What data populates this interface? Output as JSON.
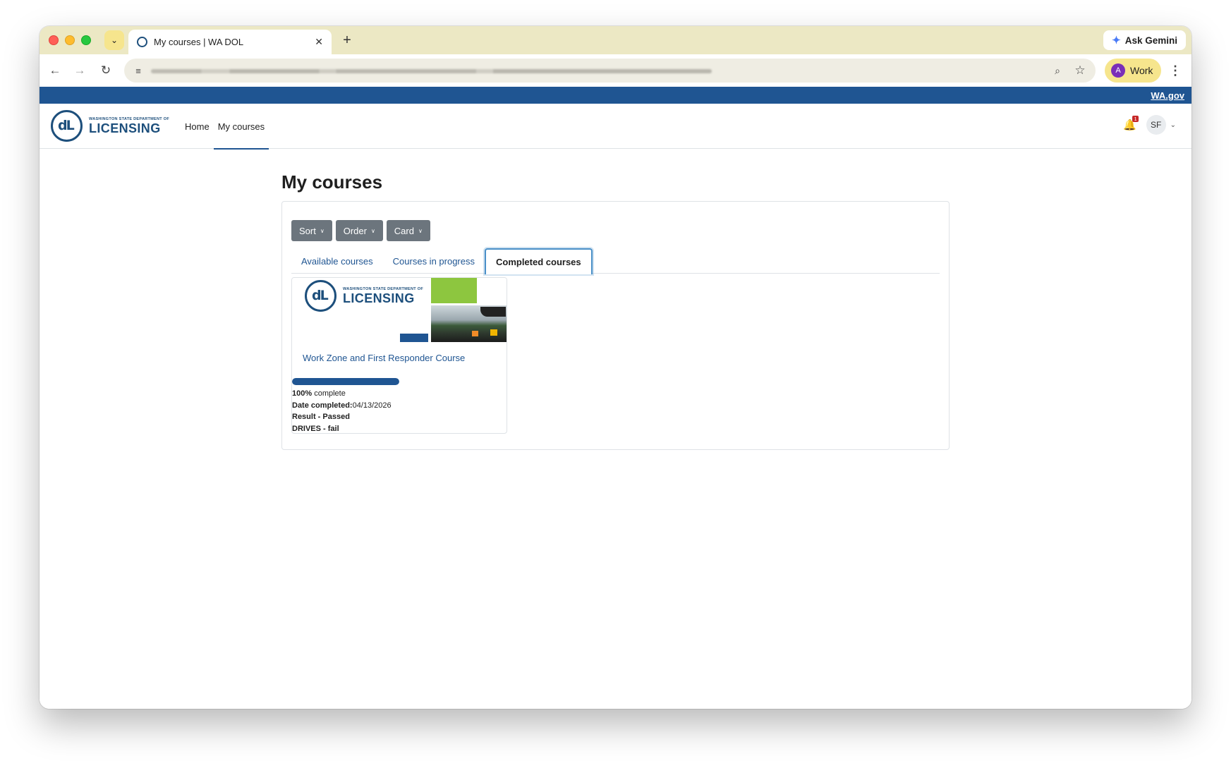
{
  "browser": {
    "tab_title": "My courses | WA DOL",
    "new_tab_label": "+",
    "ask_gemini_label": "Ask Gemini",
    "profile_initial": "A",
    "profile_label": "Work"
  },
  "site": {
    "gov_link": "WA.gov",
    "logo_small": "WASHINGTON STATE DEPARTMENT OF",
    "logo_big": "LICENSING",
    "nav": [
      "Home",
      "My courses"
    ],
    "notification_count": "1",
    "user_initials": "SF"
  },
  "page": {
    "title": "My courses",
    "dropdowns": [
      "Sort",
      "Order",
      "Card"
    ],
    "tabs": [
      "Available courses",
      "Courses in progress",
      "Completed courses"
    ],
    "active_tab": "Completed courses"
  },
  "course": {
    "image_logo_small": "WASHINGTON STATE DEPARTMENT OF",
    "image_logo_big": "LICENSING",
    "name": "Work Zone and First Responder Course",
    "progress_percent": 100,
    "progress_value": "100%",
    "progress_suffix": " complete",
    "date_label": "Date completed:",
    "date_value": "04/13/2026",
    "result_text": "Result - Passed",
    "drives_text": "DRIVES - fail"
  },
  "colors": {
    "gov_bar": "#1f5592",
    "accent": "#1f5592",
    "tab_strip": "#ece8c4",
    "dropdown_button": "#6c757d",
    "image_green": "#8dc63f"
  },
  "icons": [
    "back-arrow-icon",
    "forward-arrow-icon",
    "reload-icon",
    "site-settings-icon",
    "zoom-icon",
    "bookmark-star-icon",
    "menu-kebab-icon",
    "bell-icon",
    "chevron-down-icon",
    "gemini-spark-icon"
  ]
}
